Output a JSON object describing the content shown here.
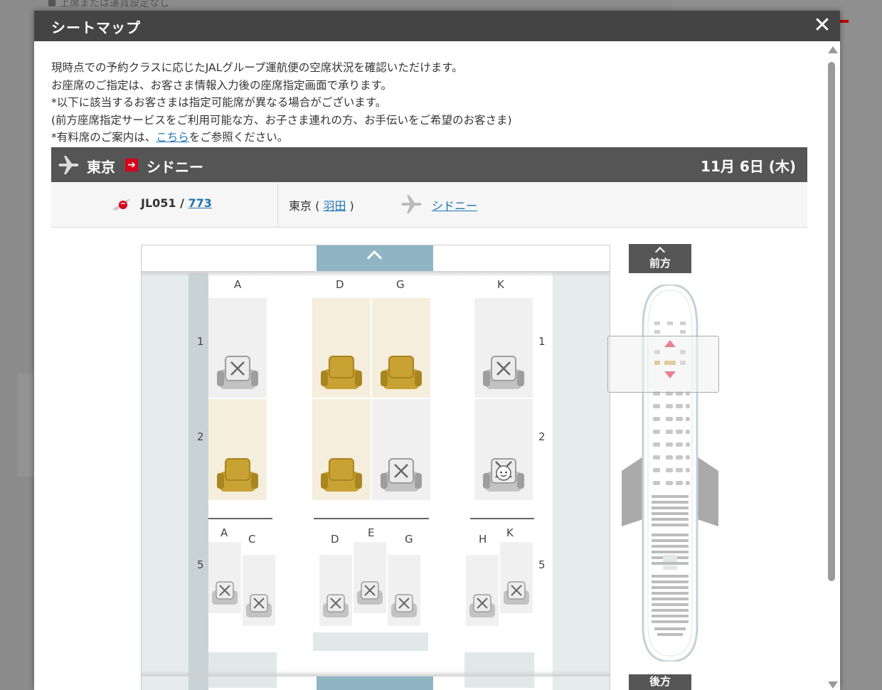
{
  "background": {
    "top_text": "・上席または運賃設定なし"
  },
  "modal": {
    "title": "シートマップ",
    "close_symbol": "✕"
  },
  "intro": {
    "line1": "現時点での予約クラスに応じたJALグループ運航便の空席状況を確認いただけます。",
    "line2": "お座席のご指定は、お客さま情報入力後の座席指定画面で承ります。",
    "line3": "*以下に該当するお客さまは指定可能席が異なる場合がございます。",
    "line4": "(前方座席指定サービスをご利用可能な方、お子さま連れの方、お手伝いをご希望のお客さま)",
    "line5_pre": "*有料席のご案内は、",
    "line5_link": "こちら",
    "line5_post": "をご参照ください。"
  },
  "route": {
    "from": "東京",
    "arrow": "➔",
    "to": "シドニー",
    "date": "11月 6日 (木)"
  },
  "flight": {
    "number": "JL051",
    "separator": " / ",
    "aircraft": "773",
    "departure_city": "東京",
    "departure_airport": "羽田",
    "arrival_city": "シドニー"
  },
  "seatmap": {
    "upper_columns": [
      "A",
      "D",
      "G",
      "K"
    ],
    "lower_columns": [
      "A",
      "C",
      "D",
      "E",
      "G",
      "H",
      "K"
    ],
    "rows": [
      "1",
      "2",
      "5"
    ],
    "legend_colors": {
      "available": "#c9a234",
      "unavailable": "#bdbdbd"
    }
  },
  "overview": {
    "forward_label": "前方",
    "aft_label": "後方"
  }
}
